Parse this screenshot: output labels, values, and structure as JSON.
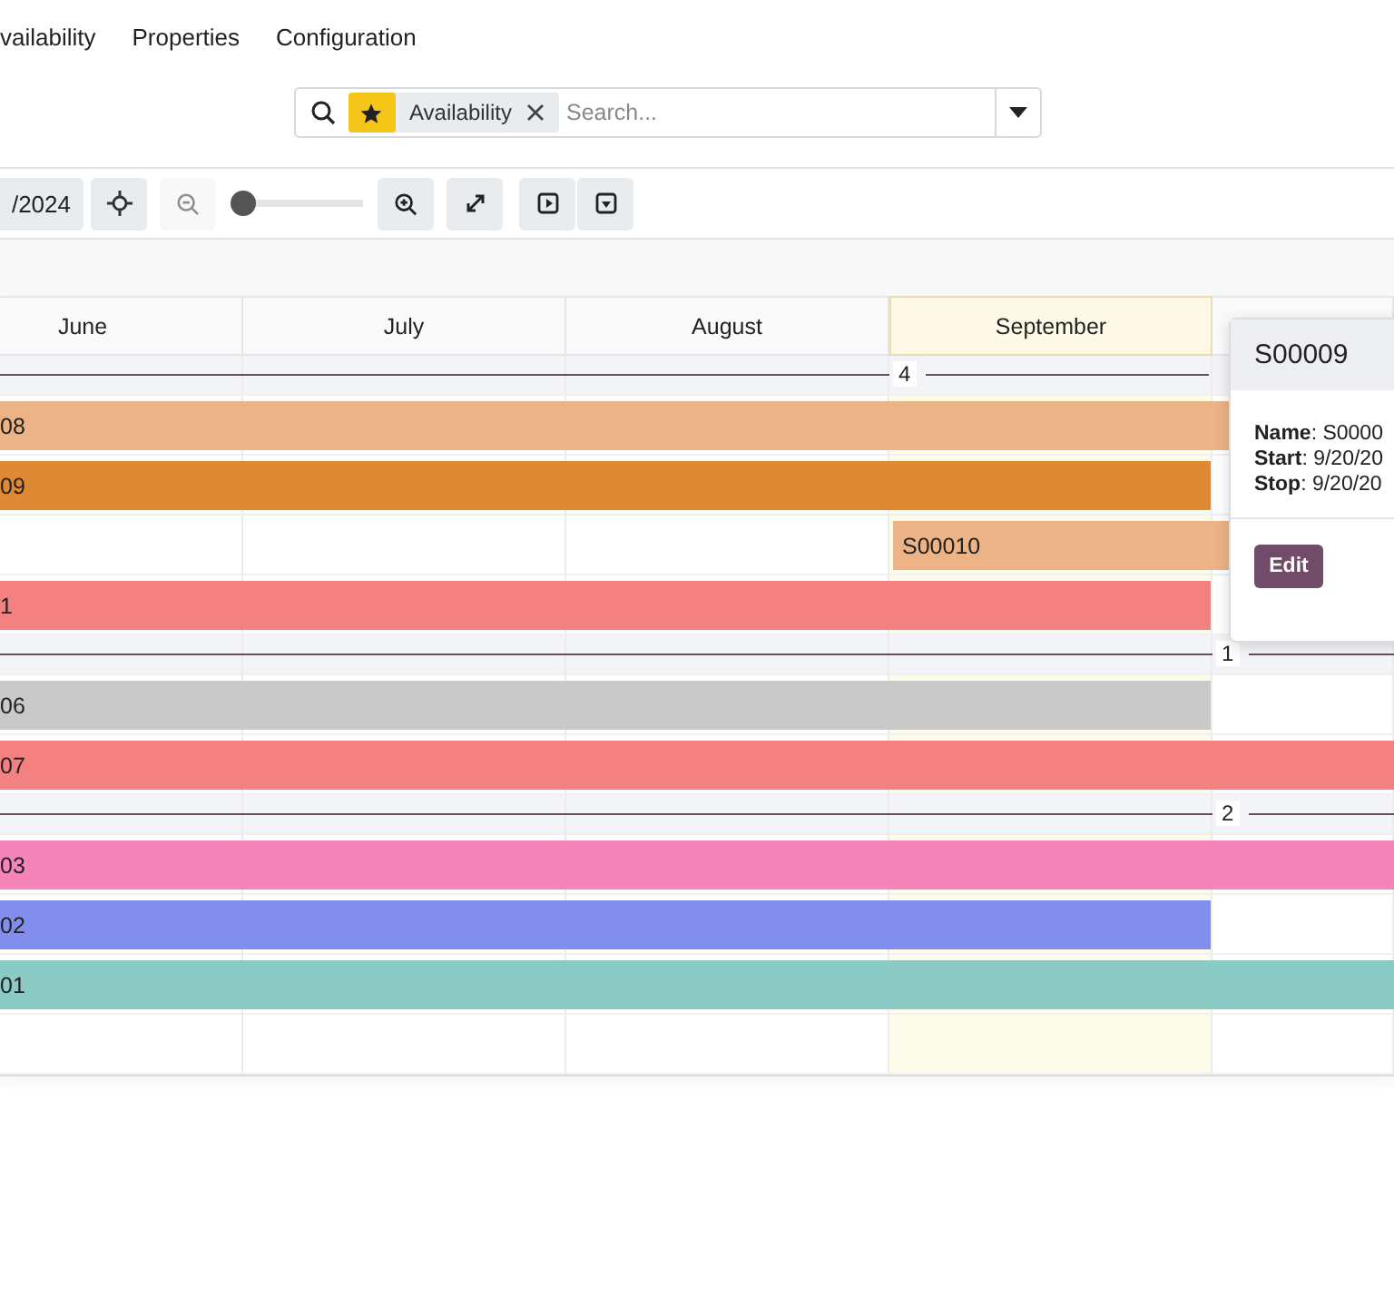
{
  "menu": [
    {
      "label": "vailability"
    },
    {
      "label": "Properties"
    },
    {
      "label": "Configuration"
    }
  ],
  "search": {
    "facet": "Availability",
    "placeholder": "Search..."
  },
  "toolbar": {
    "date": "/2024",
    "zoom_out_disabled": true,
    "zoom": {
      "level": 0
    }
  },
  "months": [
    {
      "label": "June",
      "highlighted": false
    },
    {
      "label": "July",
      "highlighted": false
    },
    {
      "label": "August",
      "highlighted": false
    },
    {
      "label": "September",
      "highlighted": true
    },
    {
      "highlighted": false
    }
  ],
  "rows": [
    {
      "kind": "group-short",
      "count": "4"
    },
    {
      "kind": "bar",
      "label": "08",
      "color": "#ebb386",
      "starts_before_view": true,
      "continues": true
    },
    {
      "kind": "bar",
      "label": "09",
      "color": "#e08934",
      "starts_before_view": true,
      "continues": false
    },
    {
      "kind": "bar",
      "label": "S00010",
      "color": "#ebb386",
      "starts_before_view": false,
      "continues": true
    },
    {
      "kind": "bar",
      "label": "1",
      "color": "#f38181",
      "starts_before_view": true,
      "continues": false
    },
    {
      "kind": "group-long",
      "count": "1"
    },
    {
      "kind": "bar",
      "label": "06",
      "color": "#c9c9c9",
      "starts_before_view": true,
      "continues": false
    },
    {
      "kind": "bar",
      "label": "07",
      "color": "#f38181",
      "starts_before_view": true,
      "continues": true
    },
    {
      "kind": "group-long",
      "count": "2"
    },
    {
      "kind": "bar",
      "label": "03",
      "color": "#f584b9",
      "starts_before_view": true,
      "continues": true
    },
    {
      "kind": "bar",
      "label": "02",
      "color": "#828eeb",
      "starts_before_view": true,
      "continues": false
    },
    {
      "kind": "bar",
      "label": "01",
      "color": "#8ccac6",
      "starts_before_view": true,
      "continues": true
    },
    {
      "kind": "empty"
    }
  ],
  "popover": {
    "title": "S00009",
    "fields": [
      "**Name**: S0000",
      "**Start**: 9/20/20",
      "**Stop**: 9/20/20"
    ],
    "button": "Edit"
  }
}
